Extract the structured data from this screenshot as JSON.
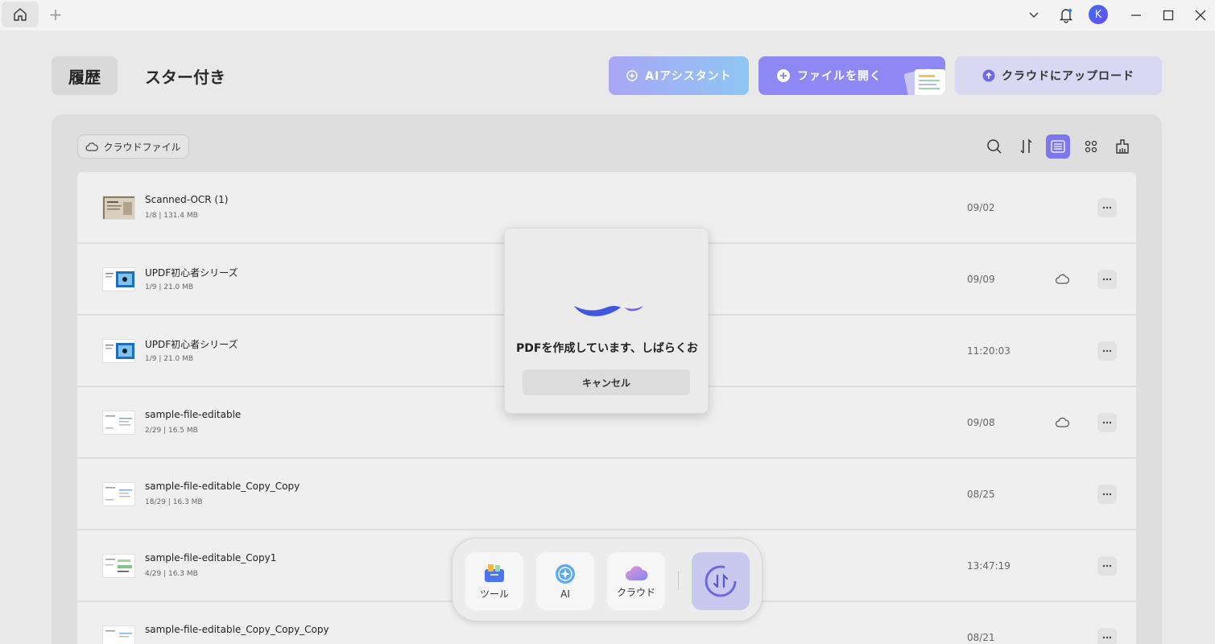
{
  "tabs": {
    "history": "履歴",
    "starred": "スター付き"
  },
  "header_buttons": {
    "ai_assistant": "AIアシスタント",
    "open_file": "ファイルを開く",
    "upload_cloud": "クラウドにアップロード"
  },
  "filter": {
    "cloud_files": "クラウドファイル"
  },
  "titlebar": {
    "avatar_initial": "K"
  },
  "files": [
    {
      "name": "Scanned-OCR (1)",
      "meta": "1/8 | 131.4 MB",
      "date": "09/02",
      "cloud": false
    },
    {
      "name": "UPDF初心者シリーズ",
      "meta": "1/9 | 21.0 MB",
      "date": "09/09",
      "cloud": true
    },
    {
      "name": "UPDF初心者シリーズ",
      "meta": "1/9 | 21.0 MB",
      "date": "11:20:03",
      "cloud": false
    },
    {
      "name": "sample-file-editable",
      "meta": "2/29 | 16.5 MB",
      "date": "09/08",
      "cloud": true
    },
    {
      "name": "sample-file-editable_Copy_Copy",
      "meta": "18/29 | 16.3 MB",
      "date": "08/25",
      "cloud": false
    },
    {
      "name": "sample-file-editable_Copy1",
      "meta": "4/29 | 16.3 MB",
      "date": "13:47:19",
      "cloud": false
    },
    {
      "name": "sample-file-editable_Copy_Copy_Copy",
      "meta": "",
      "date": "08/21",
      "cloud": false
    }
  ],
  "dialog": {
    "message": "PDFを作成しています、しばらくお待ちください",
    "cancel": "キャンセル"
  },
  "dock": {
    "tools": "ツール",
    "ai": "AI",
    "cloud": "クラウド"
  },
  "colors": {
    "accent": "#7c77ee",
    "wave": "#4a5be6"
  }
}
